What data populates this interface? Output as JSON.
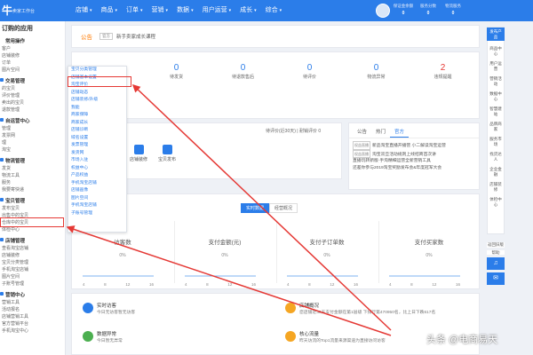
{
  "app": {
    "logo": "牛",
    "logo_sub": "卖家工作台"
  },
  "nav": [
    {
      "label": "店铺",
      "caret": "▾"
    },
    {
      "label": "商品",
      "caret": "▾"
    },
    {
      "label": "订单",
      "caret": "▾"
    },
    {
      "label": "营销",
      "caret": "▾"
    },
    {
      "label": "数据",
      "caret": "▾"
    },
    {
      "label": "用户运营",
      "caret": "▾"
    },
    {
      "label": "成长",
      "caret": "▾"
    },
    {
      "label": "综合",
      "caret": "▾"
    }
  ],
  "top_stats": [
    {
      "label": "保证金余额",
      "value": "0"
    },
    {
      "label": "服务分数",
      "value": "0"
    },
    {
      "label": "物流服务",
      "value": "0"
    }
  ],
  "sidebar": {
    "header": "订购的应用",
    "common": {
      "title": "常用操作",
      "links": [
        "客户",
        "店铺装修",
        "订单",
        "图片空间"
      ]
    },
    "sections": [
      {
        "title": "交易管理",
        "links": [
          "的宝贝",
          "评价管理",
          "卖出的宝贝",
          "退款管理"
        ]
      },
      {
        "title": "自运营中心",
        "links": [
          "管理",
          "发票网",
          "理",
          "淘宝"
        ]
      },
      {
        "title": "物流管理",
        "links": [
          "发货",
          "物流工具",
          "服务",
          "我要寄快递"
        ]
      },
      {
        "title": "宝贝管理",
        "links": [
          "发布宝贝",
          "出售中的宝贝",
          "仓库中的宝贝",
          "体检中心"
        ]
      },
      {
        "title": "店铺管理",
        "links": [
          "查看淘宝店铺",
          "店铺装修",
          "宝贝分类管理",
          "手机淘宝店铺",
          "图片空间",
          "子账号管理"
        ]
      },
      {
        "title": "营销中心",
        "links": [
          "营销工具",
          "活动报名",
          "店铺营销工具",
          "官方营销平台",
          "手机淘宝中心"
        ]
      }
    ]
  },
  "notice": {
    "label": "公告",
    "tag": "官方",
    "text": "新手卖家成长课程"
  },
  "numbers": [
    {
      "value": "0",
      "label": "待发货"
    },
    {
      "value": "0",
      "label": "待退款售后"
    },
    {
      "value": "0",
      "label": "待评价"
    },
    {
      "value": "0",
      "label": "物流异常"
    },
    {
      "value": "2",
      "label": "违规提醒"
    }
  ],
  "eval_text": "待评价(近30天) | 耐销评价 0",
  "tools": [
    {
      "label": "店铺装修"
    },
    {
      "label": "宝贝发布"
    }
  ],
  "info_tabs": [
    "公告",
    "热门",
    "官方"
  ],
  "news": [
    {
      "tag": "权益直播",
      "text": "新品淘宝直播开播营 小二解读淘宝运营"
    },
    {
      "tag": "权益直播",
      "text": "淘宝双旦活动规则上线招商首次讲"
    },
    {
      "tag": "",
      "text": "直播玩转新版·手淘精细运营全新营销工具"
    },
    {
      "tag": "",
      "text": "还差你参与2019淘宝奖励发布会&年度冠军大会"
    }
  ],
  "dash_tabs": [
    "实时数据",
    "经营概况"
  ],
  "metrics": [
    {
      "name": "访客数",
      "pct": "0%"
    },
    {
      "name": "支付金额(元)",
      "pct": "0%"
    },
    {
      "name": "支付子订单数",
      "pct": "0%"
    },
    {
      "name": "支付买家数",
      "pct": "0%"
    }
  ],
  "chart_axis": [
    "4",
    "8",
    "12",
    "16"
  ],
  "bottom": [
    {
      "title": "实时访客",
      "desc": "今日无访客暂无访客",
      "color": "#2b7de9"
    },
    {
      "title": "店铺概况",
      "desc": "您店铺近30天支付金额在第1层级 下排行第470950名，比上日下跌617名",
      "color": "#f5a623"
    },
    {
      "title": "数据异常",
      "desc": "今日暂无异常",
      "color": "#4caf50"
    },
    {
      "title": "核心流量",
      "desc": "昨天访流的Top1流量来源渠道为直接访问访客",
      "color": "#f5a623"
    }
  ],
  "dropdown": [
    "宝贝分类管理",
    "店铺基本设置",
    "淘宝评价",
    "店铺动态",
    "店铺装修/升级",
    "我能",
    "商家保障",
    "商家成长",
    "店铺诊断",
    "域名设置",
    "发票管理",
    "发货网",
    "市场入驻",
    "权益中心",
    "产品权益",
    "手机淘宝店铺",
    "店铺画像",
    "图片空间",
    "手机淘宝店铺",
    "子账号管理"
  ],
  "rightbar": [
    "发布产品",
    "商品中心",
    "用户运营",
    "营销活动",
    "数据中心",
    "智慧建站",
    "品牌商家",
    "服务市场",
    "找货达人",
    "企业金融",
    "店铺装修",
    "体检中心"
  ],
  "rightbar_lower": [
    "返回旧版",
    "帮助"
  ],
  "watermark": "头条 @电商易天"
}
